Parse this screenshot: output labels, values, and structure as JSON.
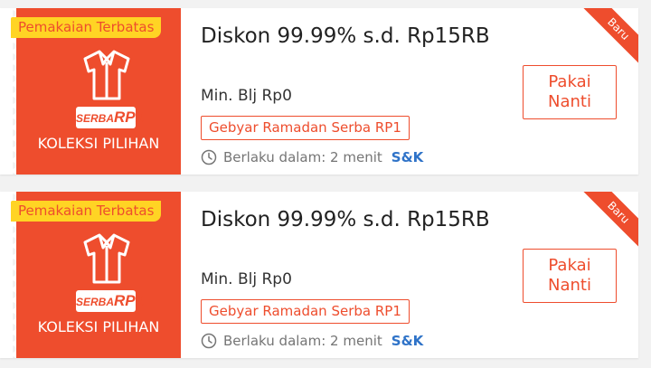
{
  "vouchers": [
    {
      "limited_badge": "Pemakaian Terbatas",
      "logo_text_a": "SERBA",
      "logo_text_b": "RP1",
      "collection": "KOLEKSI PILIHAN",
      "title": "Diskon 99.99% s.d. Rp15RB",
      "min_spend": "Min. Blj Rp0",
      "tag": "Gebyar Ramadan Serba RP1",
      "validity": "Berlaku dalam: 2 menit",
      "terms": "S&K",
      "button": "Pakai Nanti",
      "ribbon": "Baru"
    },
    {
      "limited_badge": "Pemakaian Terbatas",
      "logo_text_a": "SERBA",
      "logo_text_b": "RP1",
      "collection": "KOLEKSI PILIHAN",
      "title": "Diskon 99.99% s.d. Rp15RB",
      "min_spend": "Min. Blj Rp0",
      "tag": "Gebyar Ramadan Serba RP1",
      "validity": "Berlaku dalam: 2 menit",
      "terms": "S&K",
      "button": "Pakai Nanti",
      "ribbon": "Baru"
    }
  ],
  "icons": {
    "shirt": "shirt-icon",
    "clock": "clock-icon"
  },
  "colors": {
    "brand": "#ee4d2d",
    "badge": "#ffd424",
    "link": "#2f73c8"
  }
}
